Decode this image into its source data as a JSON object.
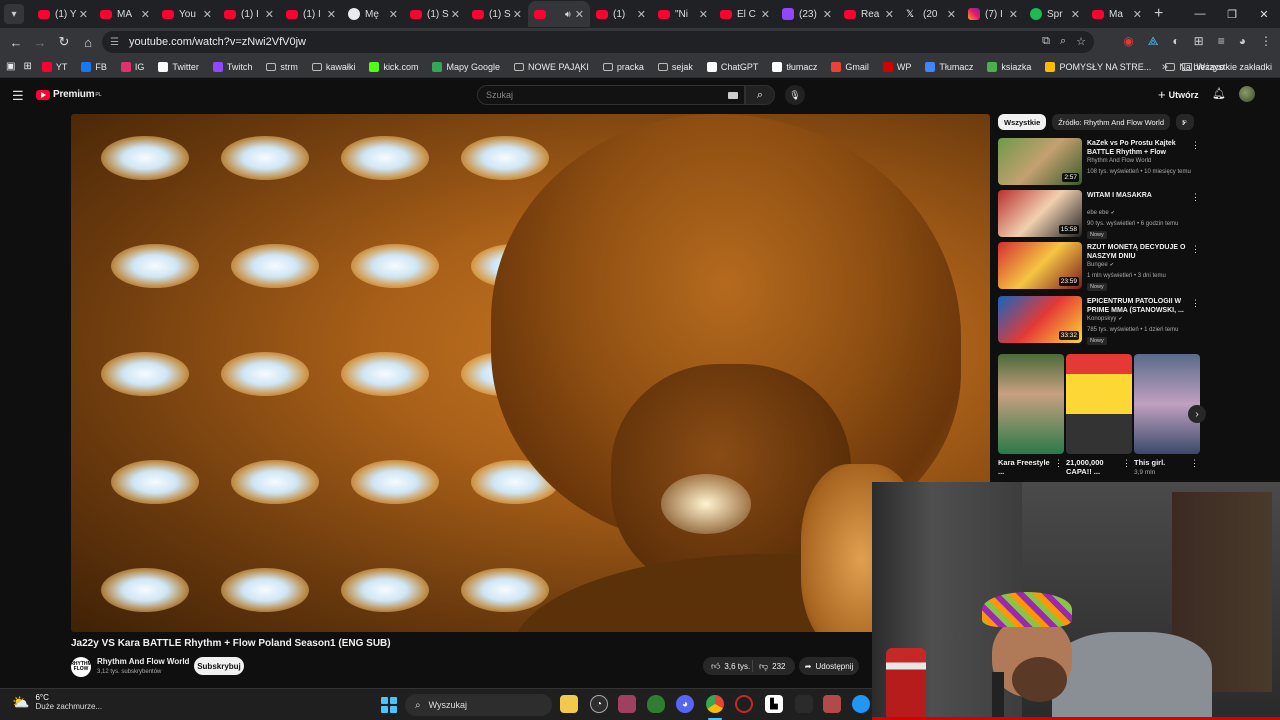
{
  "browser": {
    "tabs": [
      {
        "label": "(1) Y",
        "icon": "youtube-icon",
        "fav": "yt"
      },
      {
        "label": "MA",
        "icon": "youtube-icon",
        "fav": "yt"
      },
      {
        "label": "You",
        "icon": "youtube-icon",
        "fav": "yt"
      },
      {
        "label": "(1) I",
        "icon": "youtube-icon",
        "fav": "yt"
      },
      {
        "label": "(1) I",
        "icon": "youtube-icon",
        "fav": "yt"
      },
      {
        "label": "Mę",
        "icon": "globe-icon",
        "fav": "globe"
      },
      {
        "label": "(1) S",
        "icon": "youtube-icon",
        "fav": "yt"
      },
      {
        "label": "(1) S",
        "icon": "youtube-icon",
        "fav": "yt"
      },
      {
        "label": "",
        "icon": "youtube-icon",
        "fav": "yt",
        "active": true,
        "audio": "speaker-icon"
      },
      {
        "label": "(1) ",
        "icon": "youtube-icon",
        "fav": "yt"
      },
      {
        "label": "\"Ni",
        "icon": "youtube-icon",
        "fav": "yt"
      },
      {
        "label": "El C",
        "icon": "youtube-icon",
        "fav": "yt"
      },
      {
        "label": "(23)",
        "icon": "twitch-icon",
        "fav": "tw"
      },
      {
        "label": "Rea",
        "icon": "youtube-icon",
        "fav": "yt"
      },
      {
        "label": "(20",
        "icon": "x-icon",
        "fav": "x"
      },
      {
        "label": "(7) I",
        "icon": "instagram-icon",
        "fav": "ig"
      },
      {
        "label": "Spr",
        "icon": "spotify-icon",
        "fav": "sp"
      },
      {
        "label": "Ma",
        "icon": "youtube-icon",
        "fav": "yt"
      }
    ],
    "url": "youtube.com/watch?v=zNwi2VfV0jw",
    "bookmarks": [
      {
        "label": "YT",
        "color": "#ff0033"
      },
      {
        "label": "FB",
        "color": "#1877f2"
      },
      {
        "label": "IG",
        "color": "#e1306c"
      },
      {
        "label": "Twitter",
        "color": "#ffffff"
      },
      {
        "label": "Twitch",
        "color": "#9146ff"
      },
      {
        "label": "strm",
        "folder": true
      },
      {
        "label": "kawałki",
        "folder": true
      },
      {
        "label": "kick.com",
        "color": "#53fc18"
      },
      {
        "label": "Mapy Google",
        "color": "#34a853"
      },
      {
        "label": "NOWE PAJĄKI",
        "folder": true
      },
      {
        "label": "pracka",
        "folder": true
      },
      {
        "label": "sejak",
        "folder": true
      },
      {
        "label": "ChatGPT",
        "color": "#ffffff"
      },
      {
        "label": "tłumacz",
        "color": "#ffffff"
      },
      {
        "label": "Gmail",
        "color": "#ea4335"
      },
      {
        "label": "WP",
        "color": "#d50000"
      },
      {
        "label": "Tłumacz",
        "color": "#4285f4"
      },
      {
        "label": "ksiazka",
        "color": "#4caf50"
      },
      {
        "label": "POMYSŁY NA STRE...",
        "color": "#fbbc04"
      },
      {
        "label": "Na bieżąco",
        "folder": true
      }
    ],
    "bookmarks_more": "»",
    "bookmarks_all": "Wszystkie zakładki"
  },
  "youtube": {
    "logo_text": "Premium",
    "logo_country": "PL",
    "search_placeholder": "Szukaj",
    "create_label": "Utwórz",
    "video": {
      "title": "Ja22y VS Kara BATTLE Rhythm + Flow Poland Season1 (ENG SUB)",
      "channel_avatar_text": "RHYTHM FLOW",
      "channel": "Rhythm And Flow World",
      "subscribers": "3,12 tys. subskrybentów",
      "subscribe_label": "Subskrybuj",
      "likes": "3,6 tys.",
      "dislikes": "232",
      "share_label": "Udostępnij"
    },
    "chips": [
      "Wszystkie",
      "Źródło: Rhythm And Flow World",
      "P"
    ],
    "recommendations": [
      {
        "title": "KaZek vs Po Prostu Kajtek BATTLE Rhythm + Flow Polan...",
        "channel": "Rhythm And Flow World",
        "stats": "108 tys. wyświetleń • 10 miesięcy temu",
        "duration": "2:57",
        "badge": ""
      },
      {
        "title": "WITAM I MASAKRA",
        "channel": "ebe ebe",
        "stats": "90 tys. wyświetleń • 6 godzin temu",
        "duration": "15:58",
        "badge": "Nowy"
      },
      {
        "title": "RZUT MONETĄ DECYDUJE O NASZYM DNIU",
        "channel": "Bungee",
        "stats": "1 mln wyświetleń • 3 dni temu",
        "duration": "23:59",
        "badge": "Nowy"
      },
      {
        "title": "EPICENTRUM PATOLOGII W PRIME MMA (STANOWSKI, ...",
        "channel": "Konopskyy",
        "stats": "785 tys. wyświetleń • 1 dzień temu",
        "duration": "33:32",
        "badge": "Nowy"
      }
    ],
    "shorts": [
      {
        "title": "Kara Freestyle ...",
        "sub": ""
      },
      {
        "title": "21,000,000 CAPA!! ...",
        "sub": ""
      },
      {
        "title": "This girl.",
        "sub": "3,9 mln"
      }
    ]
  },
  "taskbar": {
    "temperature": "6°C",
    "weather": "Duże zachmurze...",
    "search_label": "Wyszukaj"
  }
}
